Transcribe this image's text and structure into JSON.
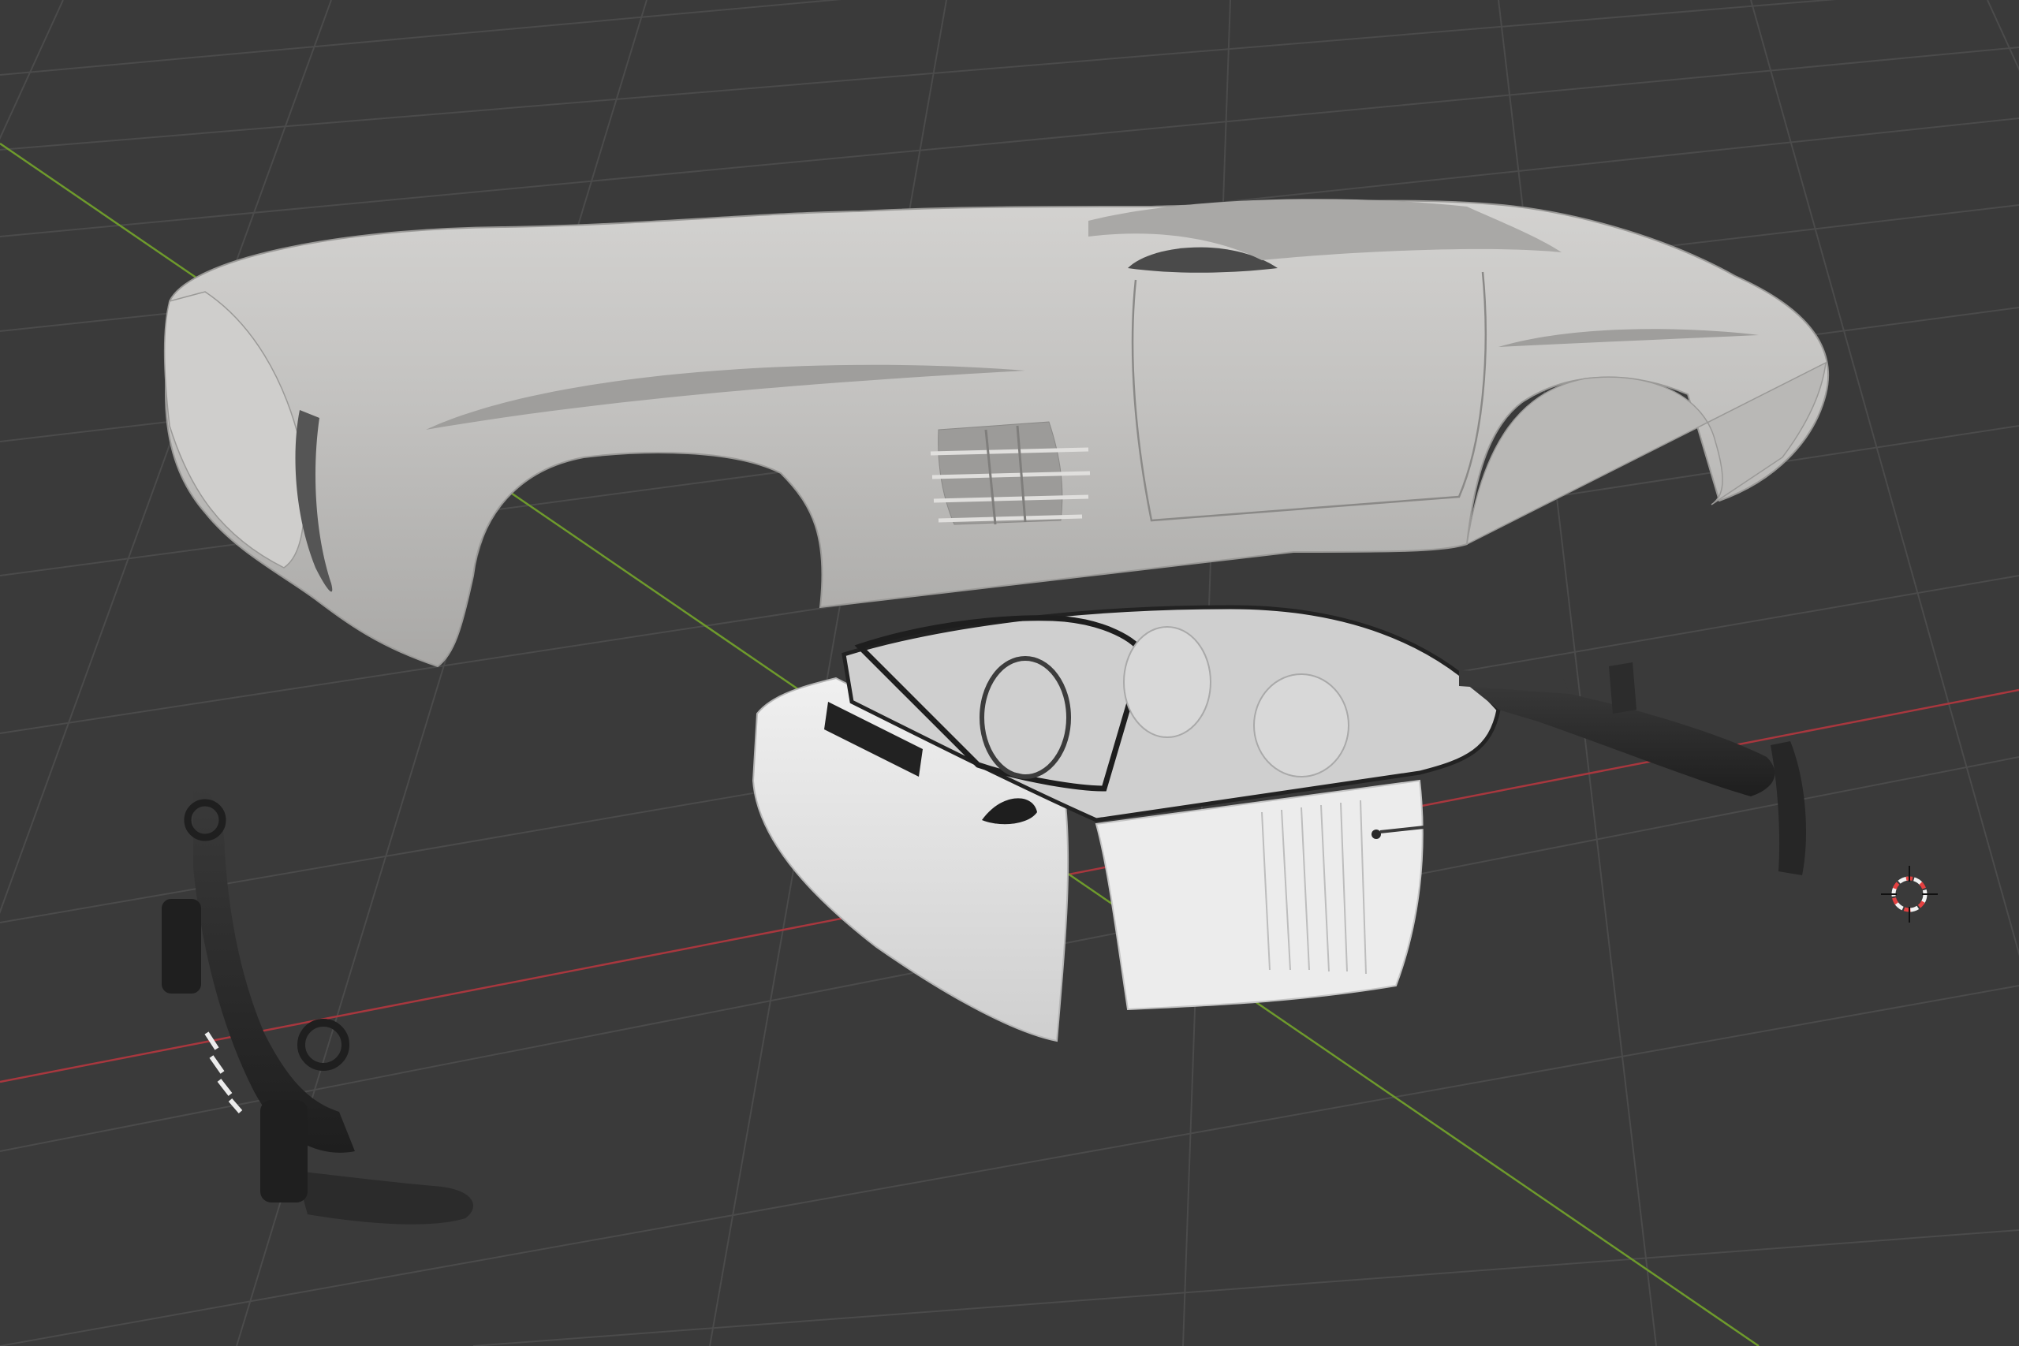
{
  "viewport": {
    "background_color": "#3a3a3a",
    "grid_color": "#4b4b4b",
    "x_axis_color": "#a8373e",
    "y_axis_color": "#6e9a2c"
  },
  "scene": {
    "objects": [
      {
        "name": "car-body-shell",
        "icon": "car-body-icon",
        "base_color": "#c4c3c1"
      },
      {
        "name": "interior-tub",
        "icon": "cockpit-icon",
        "base_color": "#e4e4e4"
      },
      {
        "name": "front-bumper-assembly",
        "icon": "bumper-icon",
        "base_color": "#2b2b2b"
      },
      {
        "name": "rear-chassis-frame",
        "icon": "chassis-icon",
        "base_color": "#2d2d2d"
      }
    ]
  },
  "cursor_3d": {
    "icon": "crosshair-cursor-icon",
    "ring_color_a": "#e44141",
    "ring_color_b": "#f2f2f2"
  }
}
